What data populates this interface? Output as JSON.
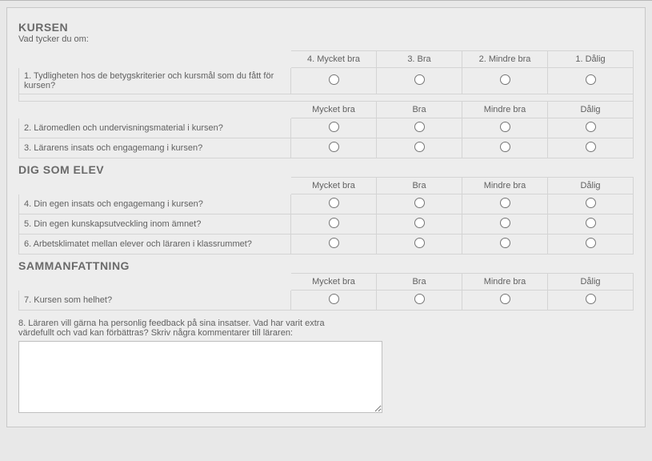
{
  "section1": {
    "title": "KURSEN",
    "subtitle": "Vad tycker du om:",
    "headers1": [
      "4. Mycket bra",
      "3. Bra",
      "2. Mindre bra",
      "1. Dålig"
    ],
    "q1": "1. Tydligheten hos de betygskriterier och kursmål som du fått för kursen?",
    "headers2": [
      "Mycket bra",
      "Bra",
      "Mindre bra",
      "Dålig"
    ],
    "q2": "2. Läromedlen och undervisningsmaterial i kursen?",
    "q3": "3. Lärarens insats och engagemang i kursen?"
  },
  "section2": {
    "title": "DIG SOM ELEV",
    "headers": [
      "Mycket bra",
      "Bra",
      "Mindre bra",
      "Dålig"
    ],
    "q4": "4. Din egen insats och engagemang i kursen?",
    "q5": "5. Din egen kunskapsutveckling inom ämnet?",
    "q6": "6. Arbetsklimatet mellan elever och läraren i klassrummet?"
  },
  "section3": {
    "title": "SAMMANFATTNING",
    "headers": [
      "Mycket bra",
      "Bra",
      "Mindre bra",
      "Dålig"
    ],
    "q7": "7. Kursen som helhet?",
    "q8": "8. Läraren vill gärna ha personlig feedback på sina insatser. Vad har varit extra värdefullt och vad kan förbättras? Skriv några kommentarer till läraren:"
  }
}
